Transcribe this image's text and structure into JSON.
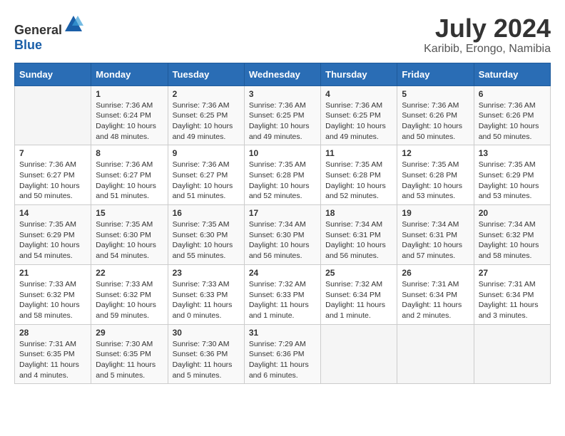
{
  "header": {
    "logo": {
      "text_general": "General",
      "text_blue": "Blue"
    },
    "title": "July 2024",
    "location": "Karibib, Erongo, Namibia"
  },
  "calendar": {
    "weekdays": [
      "Sunday",
      "Monday",
      "Tuesday",
      "Wednesday",
      "Thursday",
      "Friday",
      "Saturday"
    ],
    "weeks": [
      [
        {
          "day": "",
          "info": ""
        },
        {
          "day": "1",
          "info": "Sunrise: 7:36 AM\nSunset: 6:24 PM\nDaylight: 10 hours\nand 48 minutes."
        },
        {
          "day": "2",
          "info": "Sunrise: 7:36 AM\nSunset: 6:25 PM\nDaylight: 10 hours\nand 49 minutes."
        },
        {
          "day": "3",
          "info": "Sunrise: 7:36 AM\nSunset: 6:25 PM\nDaylight: 10 hours\nand 49 minutes."
        },
        {
          "day": "4",
          "info": "Sunrise: 7:36 AM\nSunset: 6:25 PM\nDaylight: 10 hours\nand 49 minutes."
        },
        {
          "day": "5",
          "info": "Sunrise: 7:36 AM\nSunset: 6:26 PM\nDaylight: 10 hours\nand 50 minutes."
        },
        {
          "day": "6",
          "info": "Sunrise: 7:36 AM\nSunset: 6:26 PM\nDaylight: 10 hours\nand 50 minutes."
        }
      ],
      [
        {
          "day": "7",
          "info": "Sunrise: 7:36 AM\nSunset: 6:27 PM\nDaylight: 10 hours\nand 50 minutes."
        },
        {
          "day": "8",
          "info": "Sunrise: 7:36 AM\nSunset: 6:27 PM\nDaylight: 10 hours\nand 51 minutes."
        },
        {
          "day": "9",
          "info": "Sunrise: 7:36 AM\nSunset: 6:27 PM\nDaylight: 10 hours\nand 51 minutes."
        },
        {
          "day": "10",
          "info": "Sunrise: 7:35 AM\nSunset: 6:28 PM\nDaylight: 10 hours\nand 52 minutes."
        },
        {
          "day": "11",
          "info": "Sunrise: 7:35 AM\nSunset: 6:28 PM\nDaylight: 10 hours\nand 52 minutes."
        },
        {
          "day": "12",
          "info": "Sunrise: 7:35 AM\nSunset: 6:28 PM\nDaylight: 10 hours\nand 53 minutes."
        },
        {
          "day": "13",
          "info": "Sunrise: 7:35 AM\nSunset: 6:29 PM\nDaylight: 10 hours\nand 53 minutes."
        }
      ],
      [
        {
          "day": "14",
          "info": "Sunrise: 7:35 AM\nSunset: 6:29 PM\nDaylight: 10 hours\nand 54 minutes."
        },
        {
          "day": "15",
          "info": "Sunrise: 7:35 AM\nSunset: 6:30 PM\nDaylight: 10 hours\nand 54 minutes."
        },
        {
          "day": "16",
          "info": "Sunrise: 7:35 AM\nSunset: 6:30 PM\nDaylight: 10 hours\nand 55 minutes."
        },
        {
          "day": "17",
          "info": "Sunrise: 7:34 AM\nSunset: 6:30 PM\nDaylight: 10 hours\nand 56 minutes."
        },
        {
          "day": "18",
          "info": "Sunrise: 7:34 AM\nSunset: 6:31 PM\nDaylight: 10 hours\nand 56 minutes."
        },
        {
          "day": "19",
          "info": "Sunrise: 7:34 AM\nSunset: 6:31 PM\nDaylight: 10 hours\nand 57 minutes."
        },
        {
          "day": "20",
          "info": "Sunrise: 7:34 AM\nSunset: 6:32 PM\nDaylight: 10 hours\nand 58 minutes."
        }
      ],
      [
        {
          "day": "21",
          "info": "Sunrise: 7:33 AM\nSunset: 6:32 PM\nDaylight: 10 hours\nand 58 minutes."
        },
        {
          "day": "22",
          "info": "Sunrise: 7:33 AM\nSunset: 6:32 PM\nDaylight: 10 hours\nand 59 minutes."
        },
        {
          "day": "23",
          "info": "Sunrise: 7:33 AM\nSunset: 6:33 PM\nDaylight: 11 hours\nand 0 minutes."
        },
        {
          "day": "24",
          "info": "Sunrise: 7:32 AM\nSunset: 6:33 PM\nDaylight: 11 hours\nand 1 minute."
        },
        {
          "day": "25",
          "info": "Sunrise: 7:32 AM\nSunset: 6:34 PM\nDaylight: 11 hours\nand 1 minute."
        },
        {
          "day": "26",
          "info": "Sunrise: 7:31 AM\nSunset: 6:34 PM\nDaylight: 11 hours\nand 2 minutes."
        },
        {
          "day": "27",
          "info": "Sunrise: 7:31 AM\nSunset: 6:34 PM\nDaylight: 11 hours\nand 3 minutes."
        }
      ],
      [
        {
          "day": "28",
          "info": "Sunrise: 7:31 AM\nSunset: 6:35 PM\nDaylight: 11 hours\nand 4 minutes."
        },
        {
          "day": "29",
          "info": "Sunrise: 7:30 AM\nSunset: 6:35 PM\nDaylight: 11 hours\nand 5 minutes."
        },
        {
          "day": "30",
          "info": "Sunrise: 7:30 AM\nSunset: 6:36 PM\nDaylight: 11 hours\nand 5 minutes."
        },
        {
          "day": "31",
          "info": "Sunrise: 7:29 AM\nSunset: 6:36 PM\nDaylight: 11 hours\nand 6 minutes."
        },
        {
          "day": "",
          "info": ""
        },
        {
          "day": "",
          "info": ""
        },
        {
          "day": "",
          "info": ""
        }
      ]
    ]
  }
}
